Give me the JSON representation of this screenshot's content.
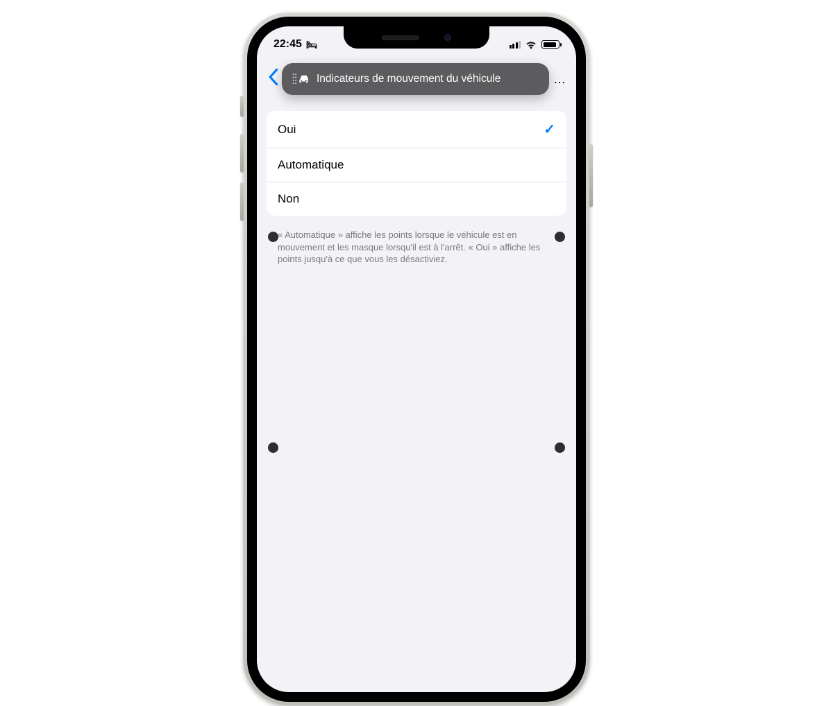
{
  "status_bar": {
    "time": "22:45",
    "sleep_mode_glyph": "🛏"
  },
  "header": {
    "title": "Indicateurs de mouvement du véhicule",
    "overflow": "…"
  },
  "options": {
    "items": [
      {
        "label": "Oui",
        "selected": true
      },
      {
        "label": "Automatique",
        "selected": false
      },
      {
        "label": "Non",
        "selected": false
      }
    ]
  },
  "footer": {
    "text": "« Automatique » affiche les points lorsque le véhicule est en mouvement et les masque lorsqu'il est à l'arrêt. « Oui » affiche les points jusqu'à ce que vous les désactiviez."
  },
  "colors": {
    "accent": "#007aff",
    "bg": "#f2f2f7",
    "pill": "#5c5c5e"
  }
}
